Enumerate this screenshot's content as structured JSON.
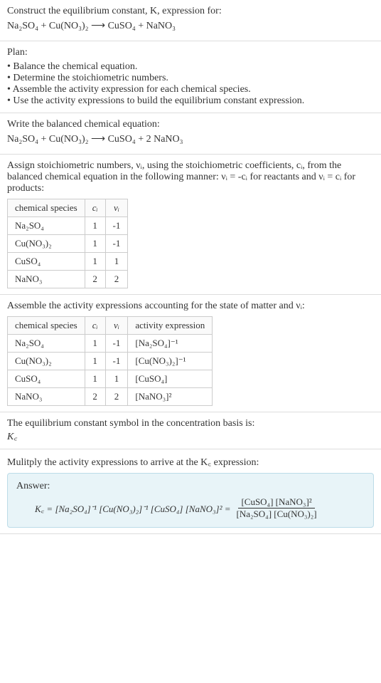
{
  "prompt": {
    "line1": "Construct the equilibrium constant, K, expression for:",
    "equation_unbalanced": "Na₂SO₄ + Cu(NO₃)₂ ⟶ CuSO₄ + NaNO₃"
  },
  "plan": {
    "heading": "Plan:",
    "items": [
      "Balance the chemical equation.",
      "Determine the stoichiometric numbers.",
      "Assemble the activity expression for each chemical species.",
      "Use the activity expressions to build the equilibrium constant expression."
    ]
  },
  "balanced": {
    "heading": "Write the balanced chemical equation:",
    "equation": "Na₂SO₄ + Cu(NO₃)₂ ⟶ CuSO₄ + 2 NaNO₃"
  },
  "stoich": {
    "heading": "Assign stoichiometric numbers, νᵢ, using the stoichiometric coefficients, cᵢ, from the balanced chemical equation in the following manner: νᵢ = -cᵢ for reactants and νᵢ = cᵢ for products:",
    "headers": {
      "species": "chemical species",
      "ci": "cᵢ",
      "vi": "νᵢ"
    },
    "rows": [
      {
        "species": "Na₂SO₄",
        "ci": "1",
        "vi": "-1"
      },
      {
        "species": "Cu(NO₃)₂",
        "ci": "1",
        "vi": "-1"
      },
      {
        "species": "CuSO₄",
        "ci": "1",
        "vi": "1"
      },
      {
        "species": "NaNO₃",
        "ci": "2",
        "vi": "2"
      }
    ]
  },
  "activity": {
    "heading": "Assemble the activity expressions accounting for the state of matter and νᵢ:",
    "headers": {
      "species": "chemical species",
      "ci": "cᵢ",
      "vi": "νᵢ",
      "expr": "activity expression"
    },
    "rows": [
      {
        "species": "Na₂SO₄",
        "ci": "1",
        "vi": "-1",
        "expr": "[Na₂SO₄]⁻¹"
      },
      {
        "species": "Cu(NO₃)₂",
        "ci": "1",
        "vi": "-1",
        "expr": "[Cu(NO₃)₂]⁻¹"
      },
      {
        "species": "CuSO₄",
        "ci": "1",
        "vi": "1",
        "expr": "[CuSO₄]"
      },
      {
        "species": "NaNO₃",
        "ci": "2",
        "vi": "2",
        "expr": "[NaNO₃]²"
      }
    ]
  },
  "symbol": {
    "heading": "The equilibrium constant symbol in the concentration basis is:",
    "value": "K꜀"
  },
  "multiply": {
    "heading": "Mulitply the activity expressions to arrive at the K꜀ expression:"
  },
  "answer": {
    "label": "Answer:",
    "kc_lhs": "K꜀ = [Na₂SO₄]⁻¹ [Cu(NO₃)₂]⁻¹ [CuSO₄] [NaNO₃]² = ",
    "frac_num": "[CuSO₄] [NaNO₃]²",
    "frac_den": "[Na₂SO₄] [Cu(NO₃)₂]"
  },
  "chart_data": {
    "type": "table",
    "tables": [
      {
        "title": "Stoichiometric numbers",
        "columns": [
          "chemical species",
          "cᵢ",
          "νᵢ"
        ],
        "rows": [
          [
            "Na₂SO₄",
            1,
            -1
          ],
          [
            "Cu(NO₃)₂",
            1,
            -1
          ],
          [
            "CuSO₄",
            1,
            1
          ],
          [
            "NaNO₃",
            2,
            2
          ]
        ]
      },
      {
        "title": "Activity expressions",
        "columns": [
          "chemical species",
          "cᵢ",
          "νᵢ",
          "activity expression"
        ],
        "rows": [
          [
            "Na₂SO₄",
            1,
            -1,
            "[Na₂SO₄]^-1"
          ],
          [
            "Cu(NO₃)₂",
            1,
            -1,
            "[Cu(NO₃)₂]^-1"
          ],
          [
            "CuSO₄",
            1,
            1,
            "[CuSO₄]"
          ],
          [
            "NaNO₃",
            2,
            2,
            "[NaNO₃]^2"
          ]
        ]
      }
    ]
  }
}
